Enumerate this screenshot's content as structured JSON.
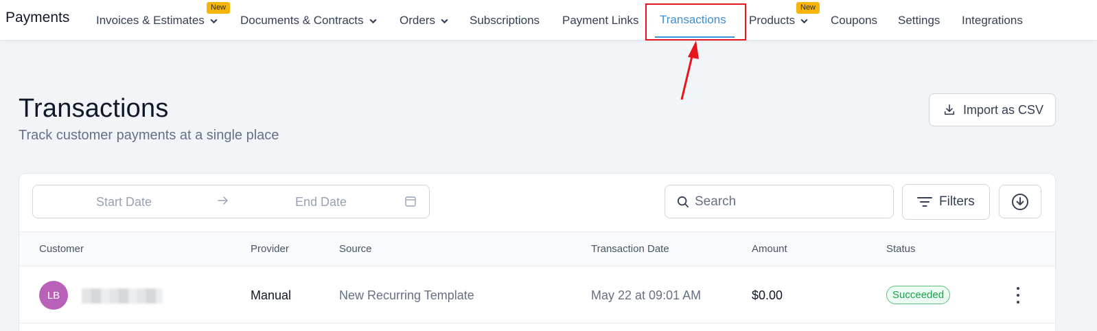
{
  "app": {
    "title": "Payments"
  },
  "nav": {
    "items": [
      {
        "label": "Invoices & Estimates",
        "badge": "New",
        "dropdown": true
      },
      {
        "label": "Documents & Contracts",
        "dropdown": true
      },
      {
        "label": "Orders",
        "dropdown": true
      },
      {
        "label": "Subscriptions"
      },
      {
        "label": "Payment Links"
      },
      {
        "label": "Transactions",
        "active": true
      },
      {
        "label": "Products",
        "badge": "New",
        "dropdown": true
      },
      {
        "label": "Coupons"
      },
      {
        "label": "Settings"
      },
      {
        "label": "Integrations"
      }
    ]
  },
  "header": {
    "title": "Transactions",
    "subtitle": "Track customer payments at a single place",
    "import_label": "Import as CSV"
  },
  "toolbar": {
    "start_date_placeholder": "Start Date",
    "end_date_placeholder": "End Date",
    "search_placeholder": "Search",
    "filters_label": "Filters"
  },
  "table": {
    "columns": [
      "Customer",
      "Provider",
      "Source",
      "Transaction Date",
      "Amount",
      "Status"
    ],
    "rows": [
      {
        "initials": "LB",
        "provider": "Manual",
        "source": "New Recurring Template",
        "date": "May 22 at 09:01 AM",
        "amount": "$0.00",
        "status": "Succeeded"
      }
    ]
  },
  "colors": {
    "accent": "#3b8fd6",
    "highlight": "#e8161c",
    "badge": "#f5b50a",
    "avatar": "#b960b9",
    "success": "#17a34a"
  }
}
